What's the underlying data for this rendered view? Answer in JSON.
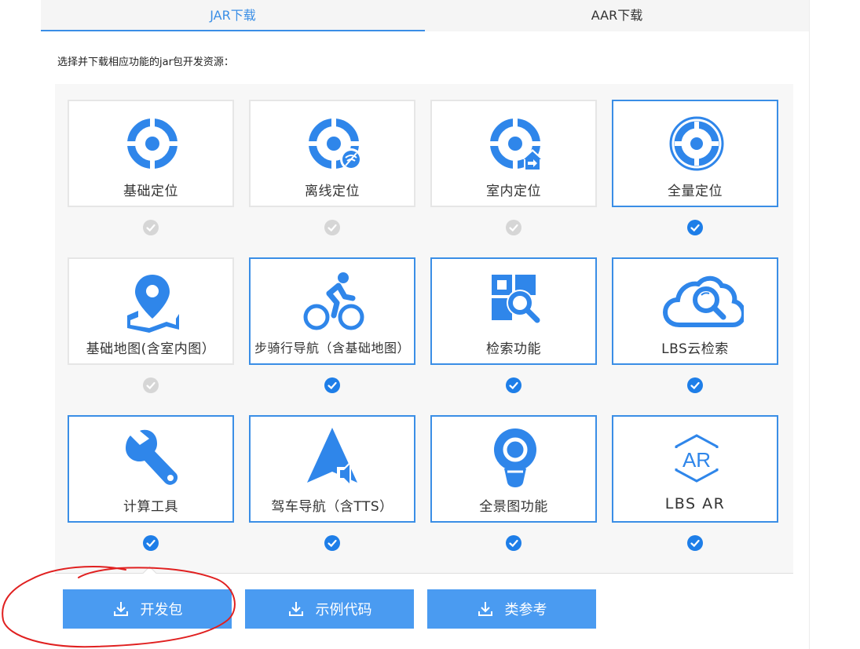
{
  "tabs": [
    {
      "label": "JAR下载",
      "active": true
    },
    {
      "label": "AAR下载",
      "active": false
    }
  ],
  "hint": "选择并下载相应功能的jar包开发资源：",
  "colors": {
    "accent": "#3a8ee6",
    "button": "#4a9bf1",
    "check_on": "#1e7ee8",
    "check_off": "#d6d6d6"
  },
  "modules": [
    {
      "label": "基础定位",
      "icon": "location-target-icon",
      "selected": false
    },
    {
      "label": "离线定位",
      "icon": "offline-location-icon",
      "selected": false
    },
    {
      "label": "室内定位",
      "icon": "indoor-location-icon",
      "selected": false
    },
    {
      "label": "全量定位",
      "icon": "full-location-icon",
      "selected": true
    },
    {
      "label": "基础地图(含室内图）",
      "icon": "map-pin-icon",
      "selected": false
    },
    {
      "label": "步骑行导航（含基础地图）",
      "icon": "cycling-icon",
      "selected": true
    },
    {
      "label": "检索功能",
      "icon": "search-grid-icon",
      "selected": true
    },
    {
      "label": "LBS云检索",
      "icon": "cloud-search-icon",
      "selected": true
    },
    {
      "label": "计算工具",
      "icon": "wrench-icon",
      "selected": true
    },
    {
      "label": "驾车导航（含TTS）",
      "icon": "navigation-arrow-icon",
      "selected": true
    },
    {
      "label": "全景图功能",
      "icon": "panorama-pin-icon",
      "selected": true
    },
    {
      "label": "LBS AR",
      "icon": "ar-hexagon-icon",
      "selected": true
    }
  ],
  "ar_icon_text": "AR",
  "buttons": [
    {
      "label": "开发包",
      "icon": "download-icon"
    },
    {
      "label": "示例代码",
      "icon": "download-icon"
    },
    {
      "label": "类参考",
      "icon": "download-icon"
    }
  ]
}
